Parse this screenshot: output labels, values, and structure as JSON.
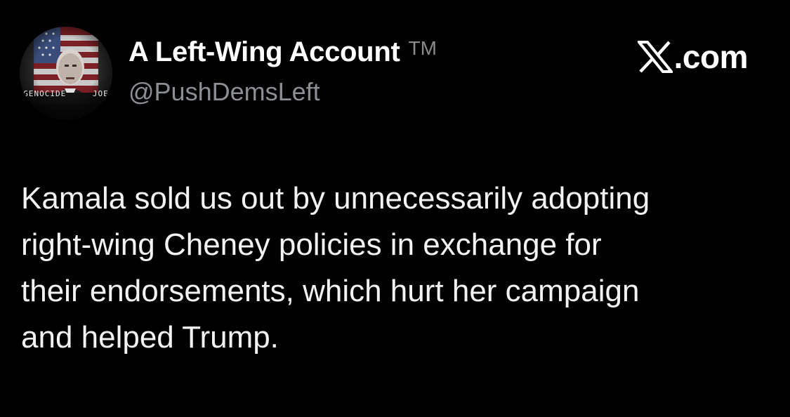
{
  "author": {
    "display_name": "A Left-Wing Account",
    "name_suffix": "TM",
    "handle": "@PushDemsLeft",
    "avatar_text": "GENOCIDE JOE"
  },
  "brand": {
    "icon": "x-logo-icon",
    "text": ".com"
  },
  "tweet": {
    "lines": [
      "Kamala sold us out by unnecessarily adopting",
      "right-wing Cheney policies in exchange for",
      "their endorsements, which hurt her campaign",
      "and helped Trump."
    ]
  },
  "colors": {
    "background": "#000000",
    "name": "#ffffff",
    "handle": "#8b8f94",
    "body_text": "#f2f2f2"
  }
}
